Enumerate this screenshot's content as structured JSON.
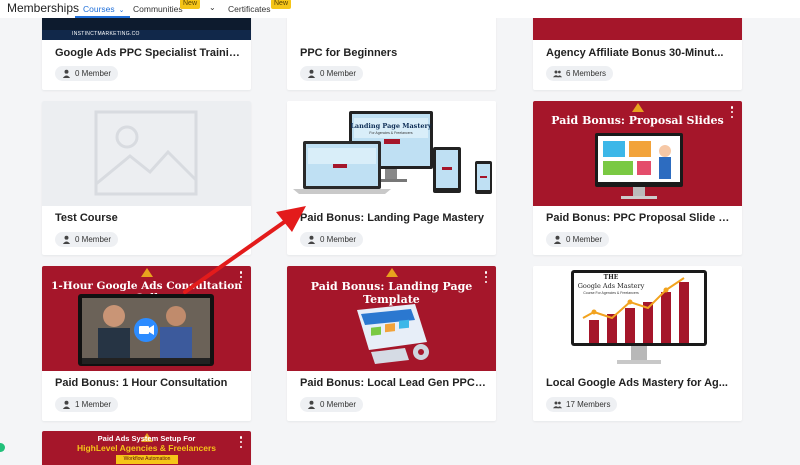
{
  "header": {
    "brand": "Memberships",
    "nav": [
      {
        "label": "Courses",
        "active": true
      },
      {
        "label": "Communities",
        "badge": "New"
      },
      {
        "label": "Certificates",
        "badge": "New"
      }
    ]
  },
  "cards": [
    {
      "title": "Google Ads PPC Specialist Trainin...",
      "members": "0 Member",
      "thumb_caption": "INSTINCTMARKETING.CO"
    },
    {
      "title": "PPC for Beginners",
      "members": "0 Member"
    },
    {
      "title": "Agency Affiliate Bonus 30-Minut...",
      "members": "6 Members"
    },
    {
      "title": "Test Course",
      "members": "0 Member"
    },
    {
      "title": "Paid Bonus: Landing Page Mastery",
      "members": "0 Member",
      "thumb_text": "Landing Page Mastery",
      "thumb_sub": "For Agencies & Freelancers"
    },
    {
      "title": "Paid Bonus: PPC Proposal Slide D...",
      "members": "0 Member",
      "thumb_text": "Paid Bonus: Proposal Slides"
    },
    {
      "title": "Paid Bonus: 1 Hour Consultation",
      "members": "1 Member",
      "thumb_text": "1-Hour Google Ads Consultation Call"
    },
    {
      "title": "Paid Bonus: Local Lead Gen PPC L...",
      "members": "0 Member",
      "thumb_text": "Paid Bonus: Landing Page Template"
    },
    {
      "title": "Local Google Ads Mastery for Ag...",
      "members": "17 Members",
      "thumb_text": "THE",
      "thumb_text2": "Google Ads Mastery",
      "thumb_sub": "Course For Agencies & Freelancers"
    },
    {
      "title": "",
      "members": "",
      "thumb_text": "Paid Ads System Setup For",
      "thumb_text2": "HighLevel Agencies & Freelancers",
      "thumb_sub": "Workflow Automation Templates"
    }
  ],
  "colors": {
    "accent": "#1f6fd9",
    "brand_red": "#a5162a",
    "badge": "#f5c518",
    "annotation_arrow": "#e31b1b"
  }
}
